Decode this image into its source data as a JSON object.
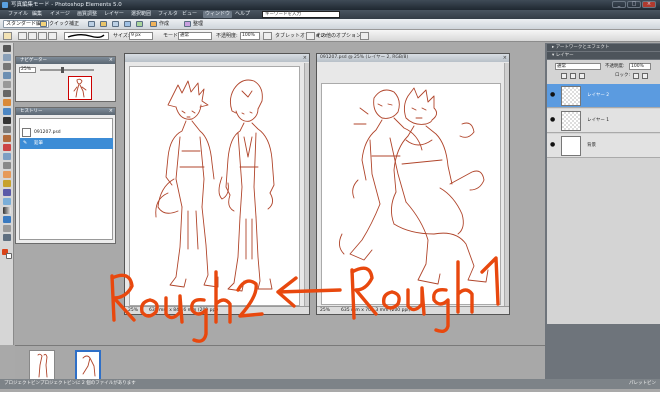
{
  "window": {
    "title": "写真編集モード - Photoshop Elements 5.0",
    "controls": [
      "_",
      "□",
      "×"
    ]
  },
  "menu": {
    "items": [
      "ファイル",
      "編集",
      "イメージ",
      "画質調整",
      "レイヤー",
      "選択範囲",
      "フィルタ",
      "ビュー",
      "ウィンドウ",
      "ヘルプ"
    ],
    "active_index": 8,
    "search_placeholder": "キーワードを入力"
  },
  "shortcuts": {
    "standard_edit": "スタンダード編集",
    "quick_fix": "クイック補正",
    "create": "作成",
    "organize": "整理"
  },
  "options": {
    "size_label": "サイズ:",
    "size_value": "9 px",
    "mode_label": "モード:",
    "mode_value": "通常",
    "opacity_label": "不透明度:",
    "opacity_value": "100%",
    "tablet_label": "タブレットオプション:",
    "other_label": "その他のオプション:"
  },
  "navigator": {
    "title": "ナビゲーター",
    "zoom": "25%"
  },
  "history": {
    "title": "ヒストリー",
    "items": [
      {
        "label": "091207.psd"
      },
      {
        "label": "鉛筆"
      }
    ],
    "selected_index": 1
  },
  "documents": [
    {
      "title": "",
      "zoom": "25%",
      "dims": "635 mm x 846.6 mm (200 ppi)"
    },
    {
      "title": "091207.psd @ 25% (レイヤー 2, RGB/8)",
      "zoom": "25%",
      "dims": "635 mm x 701.3 mm (200 ppi)"
    }
  ],
  "annotations": {
    "left": "Rough2",
    "right": "Rough1",
    "arrow": "←",
    "color": "#e8480e"
  },
  "right_panels": {
    "artwork_header": "アートワークとエフェクト",
    "layers_header": "レイヤー",
    "blend_mode": "通常",
    "opacity_label": "不透明度:",
    "opacity_value": "100%",
    "lock_label": "ロック:",
    "layers": [
      {
        "name": "レイヤー 2",
        "visible": true
      },
      {
        "name": "レイヤー 1",
        "visible": true
      },
      {
        "name": "背景",
        "visible": true
      }
    ],
    "selected_layer": 0
  },
  "project_bin": {
    "label": "プロジェクトビン",
    "status": "プロジェクトビンに 2 個のファイルがあります",
    "palette_bin": "パレットビン"
  },
  "colors": {
    "sketch_stroke": "#b0452b",
    "selection": "#3c8cd6"
  }
}
